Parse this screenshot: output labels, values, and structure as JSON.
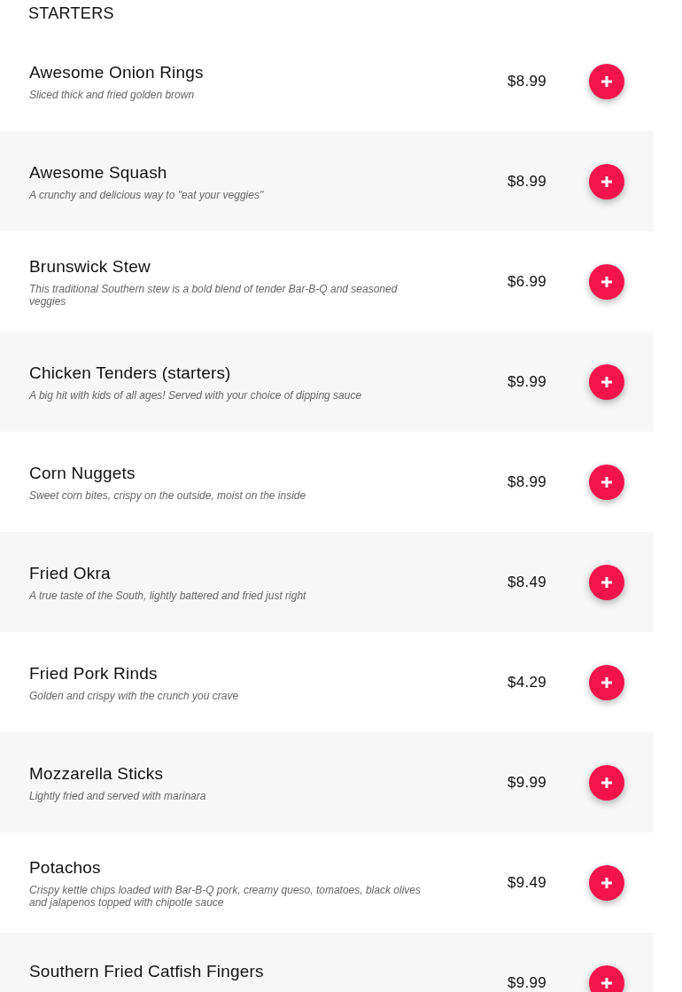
{
  "section": {
    "title": "STARTERS"
  },
  "items": [
    {
      "name": "Awesome Onion Rings",
      "description": "Sliced thick and fried golden brown",
      "price": "$8.99"
    },
    {
      "name": "Awesome Squash",
      "description": "A crunchy and delicious way to \"eat your veggies\"",
      "price": "$8.99"
    },
    {
      "name": "Brunswick Stew",
      "description": "This traditional Southern stew is a bold blend of tender Bar-B-Q and seasoned veggies",
      "price": "$6.99"
    },
    {
      "name": "Chicken Tenders (starters)",
      "description": "A big hit with kids of all ages! Served with your choice of dipping sauce",
      "price": "$9.99"
    },
    {
      "name": "Corn Nuggets",
      "description": "Sweet corn bites, crispy on the outside, moist on the inside",
      "price": "$8.99"
    },
    {
      "name": "Fried Okra",
      "description": "A true taste of the South, lightly battered and fried just right",
      "price": "$8.49"
    },
    {
      "name": "Fried Pork Rinds",
      "description": "Golden and crispy with the crunch you crave",
      "price": "$4.29"
    },
    {
      "name": "Mozzarella Sticks",
      "description": "Lightly fried and served with marinara",
      "price": "$9.99"
    },
    {
      "name": "Potachos",
      "description": "Crispy kettle chips loaded with Bar-B-Q pork, creamy queso, tomatoes, black olives and jalapenos topped with chipotle sauce",
      "price": "$9.49"
    },
    {
      "name": "Southern Fried Catfish Fingers",
      "price": "$9.99"
    }
  ]
}
